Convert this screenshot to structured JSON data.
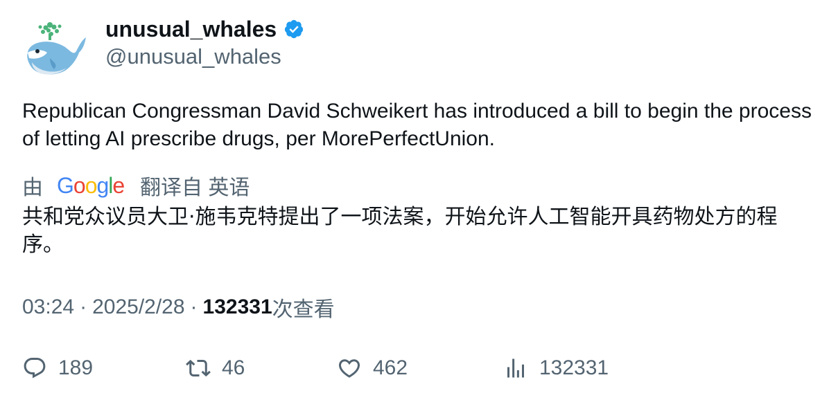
{
  "author": {
    "display_name": "unusual_whales",
    "handle": "@unusual_whales",
    "verified_color": "#1d9bf0"
  },
  "tweet": {
    "text": "Republican Congressman David Schweikert has introduced a bill to begin the process of letting AI prescribe drugs, per MorePerfectUnion."
  },
  "translation": {
    "by_label": "由",
    "provider": "Google",
    "from_label": "翻译自 英语",
    "text": "共和党众议员大卫·施韦克特提出了一项法案，开始允许人工智能开具药物处方的程序。"
  },
  "meta": {
    "time": "03:24",
    "date": "2025/2/28",
    "separator": "·",
    "views_count": "132331",
    "views_label": "次查看"
  },
  "actions": {
    "reply_count": "189",
    "retweet_count": "46",
    "like_count": "462",
    "views_count": "132331"
  }
}
